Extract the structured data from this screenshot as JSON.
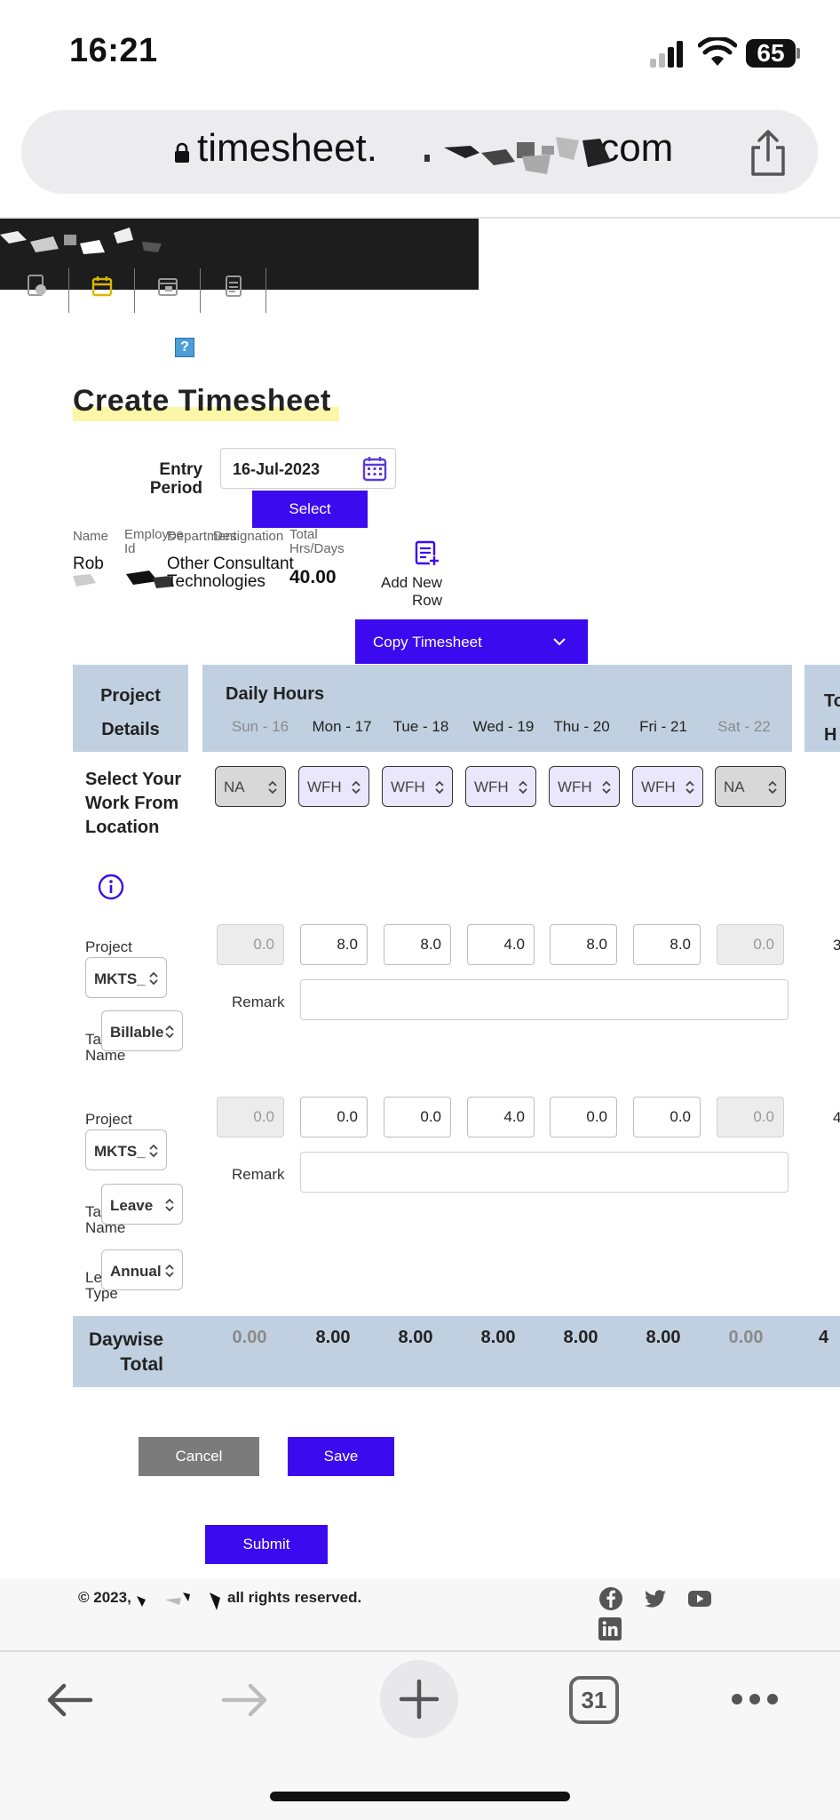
{
  "status_bar": {
    "time": "16:21",
    "battery": "65"
  },
  "browser": {
    "url": "timesheet.",
    "url_tld": ".com",
    "tabs_count": "31"
  },
  "page": {
    "title": "Create Timesheet",
    "help_icon": "?",
    "entry_period_label": "Entry Period",
    "entry_period_value": "16-Jul-2023",
    "select_label": "Select",
    "employee": {
      "name_label": "Name",
      "name_value": "Rob",
      "employee_id_label": "Employee Id",
      "department_label": "Department",
      "department_value": "Other Technologies",
      "designation_label": "Designation",
      "designation_value": "Consultant",
      "total_label": "Total Hrs/Days",
      "total_value": "40.00"
    },
    "add_new_row_label": "Add New Row",
    "copy_timesheet_label": "Copy Timesheet"
  },
  "table": {
    "project_details_header": "Project Details",
    "daily_hours_header": "Daily Hours",
    "total_header": "To H",
    "days": [
      "Sun - 16",
      "Mon - 17",
      "Tue - 18",
      "Wed - 19",
      "Thu - 20",
      "Fri - 21",
      "Sat - 22"
    ],
    "work_location_label": "Select Your Work From Location",
    "work_locations": [
      "NA",
      "WFH",
      "WFH",
      "WFH",
      "WFH",
      "WFH",
      "NA"
    ],
    "rows": [
      {
        "project_label": "Project",
        "project_value": "MKTS_",
        "task_label": "Task Name",
        "task_value": "Billable",
        "hours": [
          "0.0",
          "8.0",
          "8.0",
          "4.0",
          "8.0",
          "8.0",
          "0.0"
        ],
        "remark_label": "Remark",
        "total": "3"
      },
      {
        "project_label": "Project",
        "project_value": "MKTS_",
        "task_label": "Task Name",
        "task_value": "Leave",
        "leave_type_label": "Leave Type",
        "leave_type_value": "Annual",
        "hours": [
          "0.0",
          "0.0",
          "0.0",
          "4.0",
          "0.0",
          "0.0",
          "0.0"
        ],
        "remark_label": "Remark",
        "total": "4"
      }
    ],
    "daywise_total_label": "Daywise Total",
    "daywise_totals": [
      "0.00",
      "8.00",
      "8.00",
      "8.00",
      "8.00",
      "8.00",
      "0.00"
    ],
    "grand_total": "4"
  },
  "actions": {
    "cancel_label": "Cancel",
    "save_label": "Save",
    "submit_label": "Submit"
  },
  "footer": {
    "copyright_prefix": "© 2023,",
    "copyright_suffix": "all rights reserved."
  },
  "colors": {
    "primary": "#3b0aef",
    "table_header": "#c0d0e0",
    "cancel": "#7b7b7b",
    "header_dark": "#1d1d1d"
  }
}
